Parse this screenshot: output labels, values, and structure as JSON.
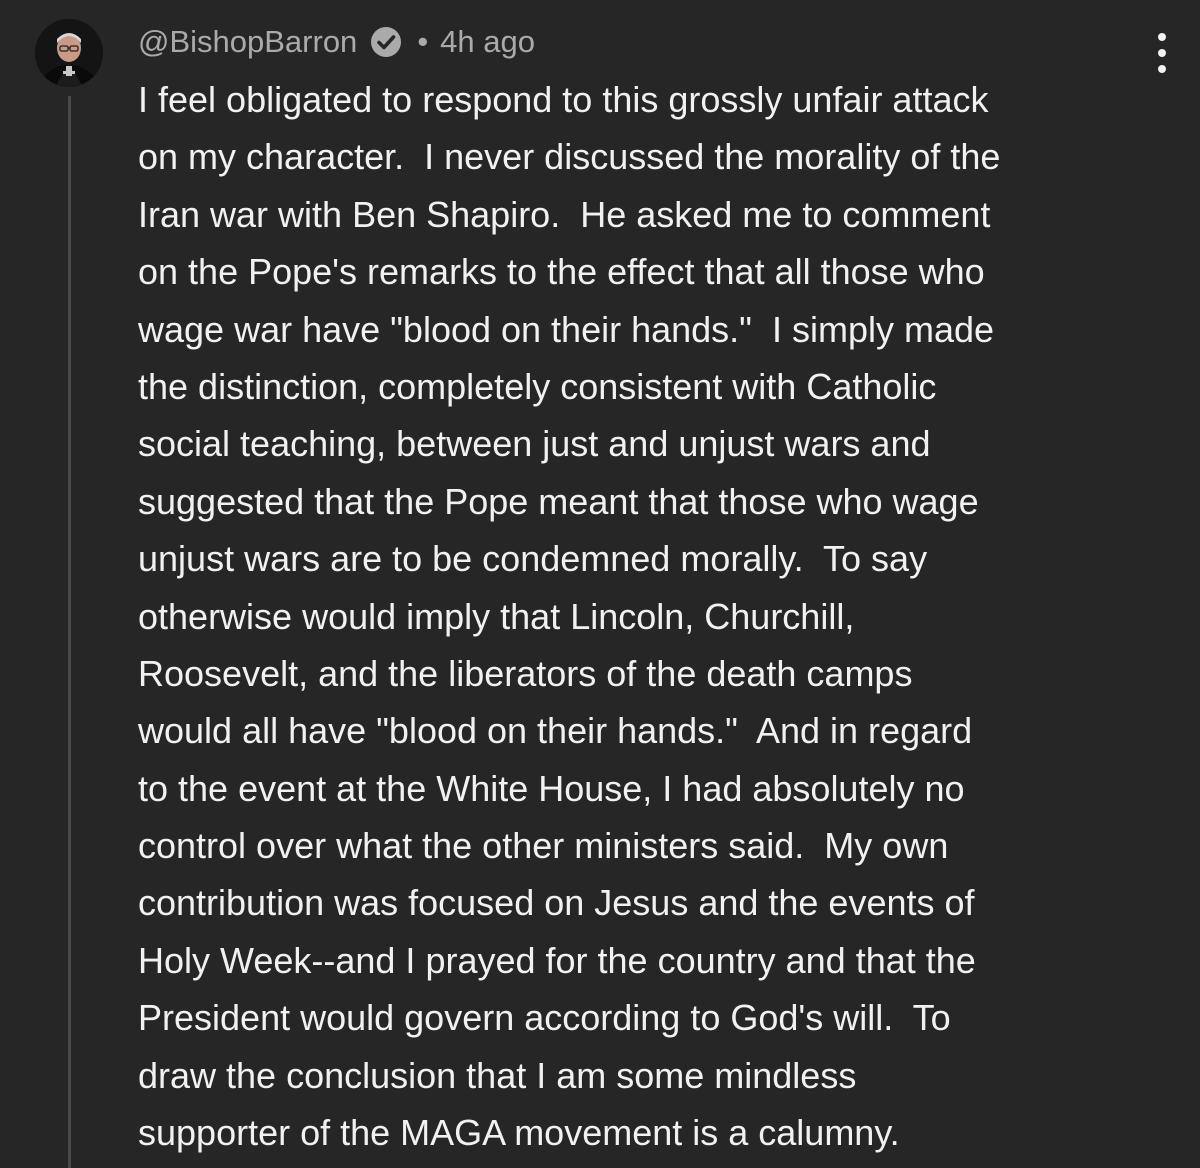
{
  "comment": {
    "author": "@BishopBarron",
    "separator": "•",
    "timestamp": "4h ago",
    "avatar_icon": "avatar-bishop-portrait",
    "verified_icon": "verified-check-icon",
    "menu_icon": "more-vertical-icon",
    "lines": [
      "I feel obligated to respond to this grossly unfair attack",
      "on my character.  I never discussed the morality of the",
      "Iran war with Ben Shapiro.  He asked me to comment",
      "on the Pope's remarks to the effect that all those who",
      "wage war have \"blood on their hands.\"  I simply made",
      "the distinction, completely consistent with Catholic",
      "social teaching, between just and unjust wars and",
      "suggested that the Pope meant that those who wage",
      "unjust wars are to be condemned morally.  To say",
      "otherwise would imply that Lincoln, Churchill,",
      "Roosevelt, and the liberators of the death camps",
      "would all have \"blood on their hands.\"  And in regard",
      "to the event at the White House, I had absolutely no",
      "control over what the other ministers said.  My own",
      "contribution was focused on Jesus and the events of",
      "Holy Week--and I prayed for the country and that the",
      "President would govern according to God's will.  To",
      "draw the conclusion that I am some mindless",
      "supporter of the MAGA movement is a calumny."
    ]
  },
  "colors": {
    "background": "#262626",
    "text": "#f1f1f1",
    "meta": "#aaaaaa",
    "thread_line": "#4a4a4a"
  }
}
